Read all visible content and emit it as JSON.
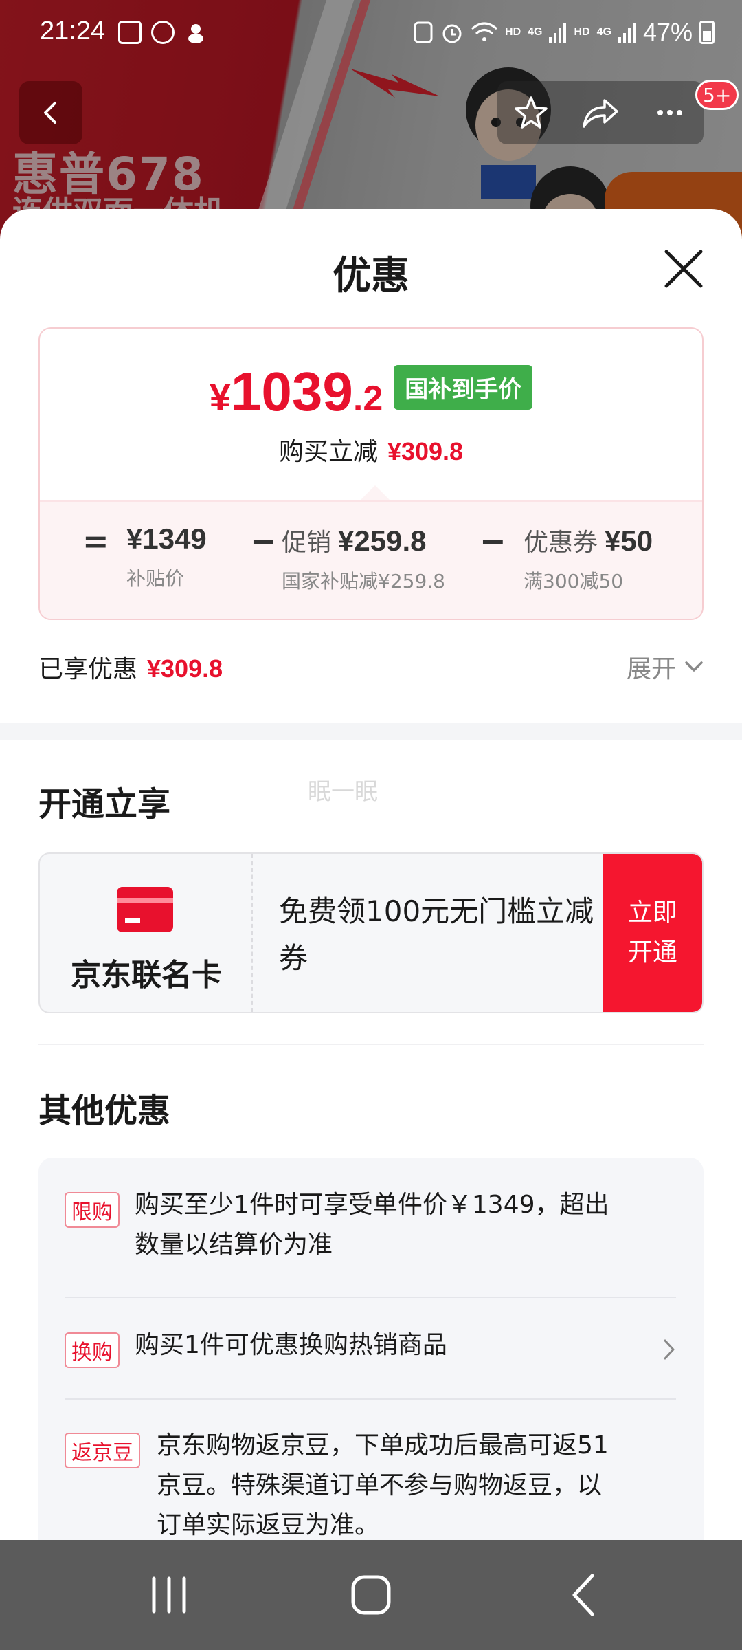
{
  "status_bar": {
    "time": "21:24",
    "network_left": "HD",
    "network_right": "HD",
    "signal_left": "4G",
    "signal_right": "4G",
    "battery": "47%"
  },
  "background": {
    "brand_text": "惠普678",
    "brand_subtext": "连供双面一体机",
    "more_badge": "5+"
  },
  "sheet": {
    "title": "优惠",
    "price_card": {
      "currency": "¥",
      "price_integer": "1039",
      "price_decimal": ".2",
      "tag": "国补到手价",
      "reduction_label": "购买立减",
      "reduction_value": "¥309.8",
      "breakdown": {
        "equals": "=",
        "minus": "−",
        "base_value": "¥1349",
        "base_label": "补贴价",
        "promo_label": "促销",
        "promo_value": "¥259.8",
        "promo_sub": "国家补贴减¥259.8",
        "coupon_label": "优惠券",
        "coupon_value": "¥50",
        "coupon_sub": "满300减50"
      }
    },
    "enjoyed": {
      "label": "已享优惠",
      "value": "¥309.8",
      "expand_label": "展开"
    },
    "open_section": {
      "title": "开通立享",
      "watermark": "眠一眠",
      "card_name": "京东联名卡",
      "card_desc": "免费领100元无门槛立减券",
      "button_line1": "立即",
      "button_line2": "开通"
    },
    "other_section": {
      "title": "其他优惠",
      "items": [
        {
          "tag": "限购",
          "text": "购买至少1件时可享受单件价￥1349，超出数量以结算价为准",
          "has_arrow": false
        },
        {
          "tag": "换购",
          "text": "购买1件可优惠换购热销商品",
          "has_arrow": true
        },
        {
          "tag": "返京豆",
          "text": "京东购物返京豆，下单成功后最高可返51京豆。特殊渠道订单不参与购物返豆，以订单实际返豆为准。",
          "has_arrow": false
        }
      ]
    }
  },
  "colors": {
    "accent_red": "#e8112d",
    "tag_green": "#3fae4a",
    "button_red": "#f5162f"
  },
  "icons": {
    "back": "chevron-left-icon",
    "favorite": "star-icon",
    "share": "share-icon",
    "more": "more-dots-icon",
    "close": "close-icon",
    "expand": "chevron-down-icon",
    "nav_recent": "recent-apps-icon",
    "nav_home": "home-icon",
    "nav_back": "back-icon"
  }
}
